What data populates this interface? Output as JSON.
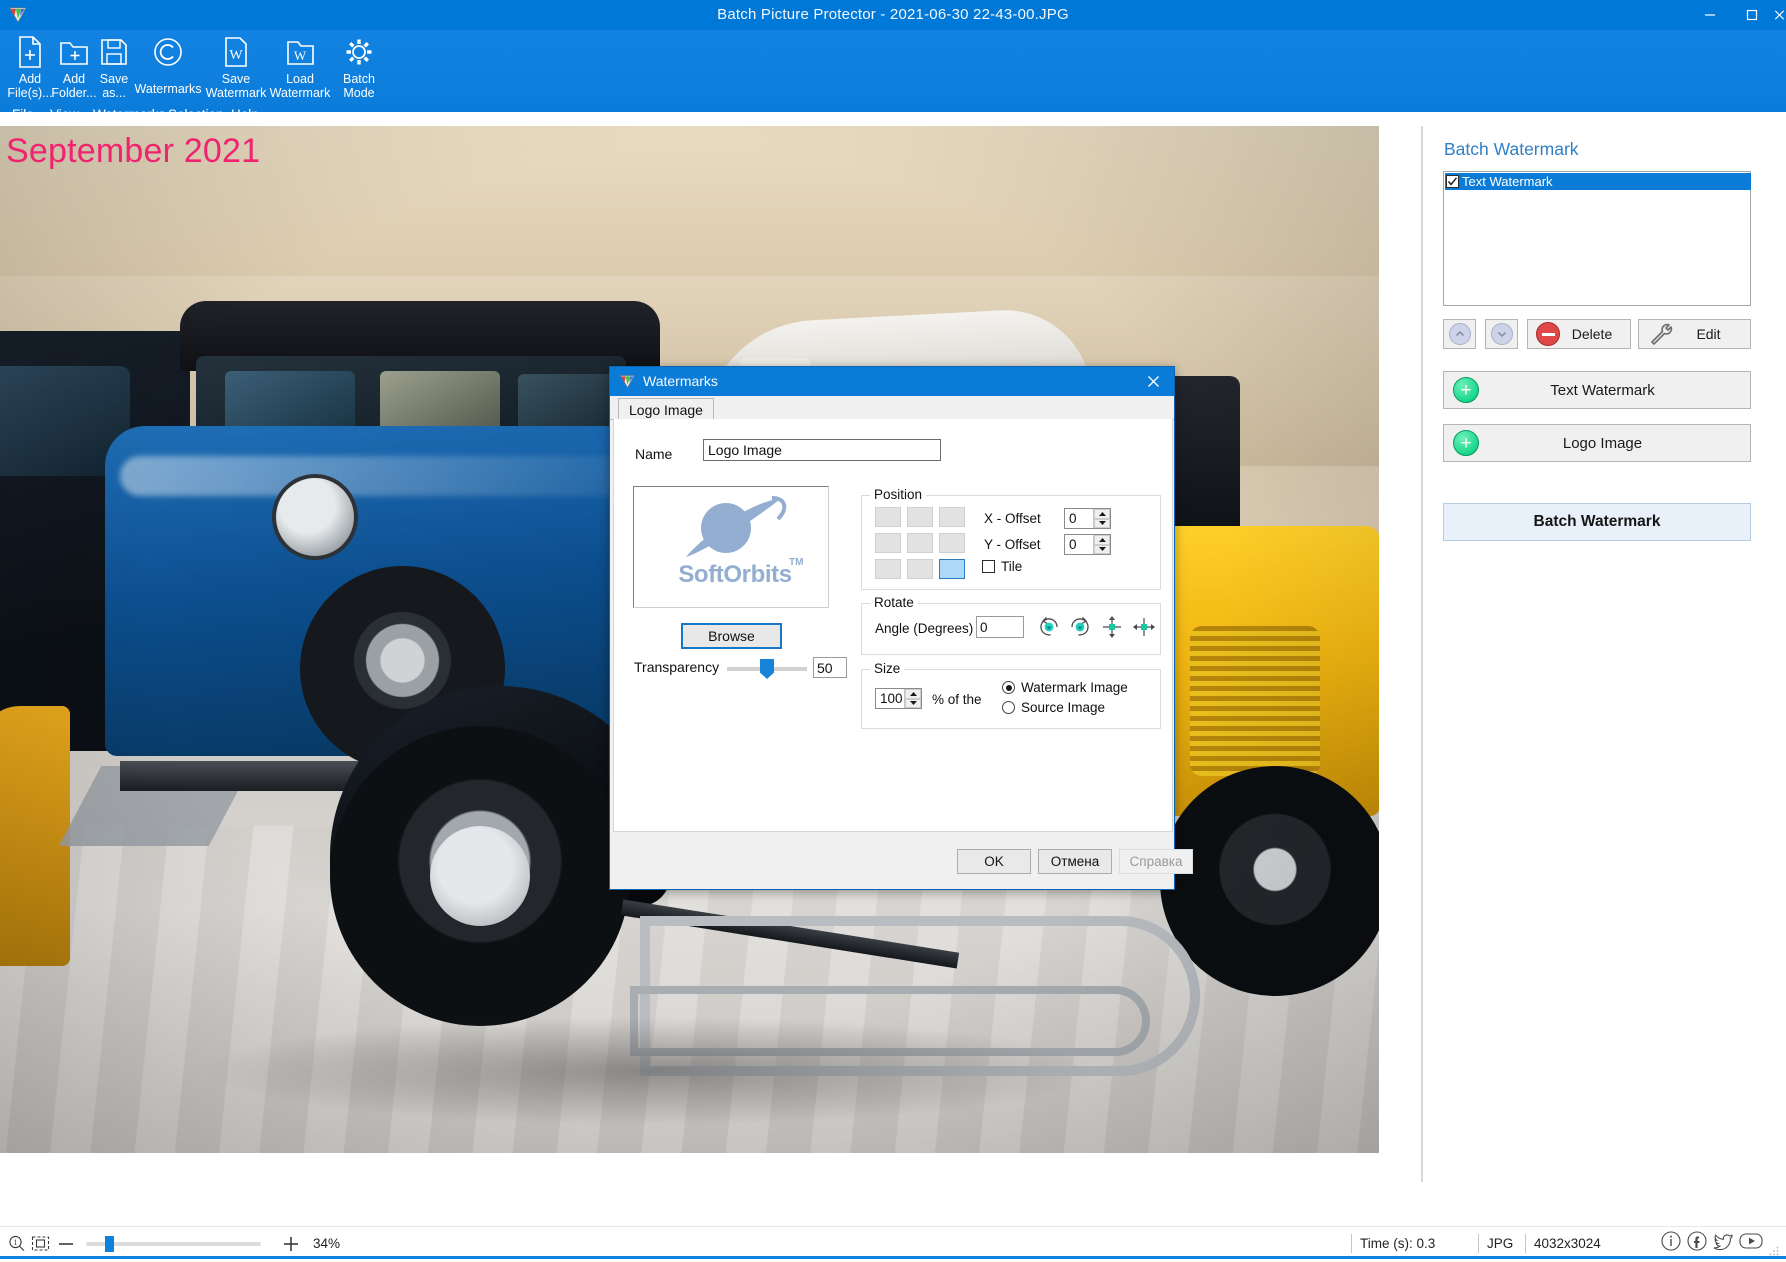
{
  "window": {
    "title": "Batch Picture Protector - 2021-06-30 22-43-00.JPG",
    "app_icon": "app-logo-icon",
    "controls": {
      "minimize": "minimize-icon",
      "maximize": "maximize-icon",
      "close": "close-icon"
    },
    "accent_color": "#0b82e0"
  },
  "toolbar": {
    "buttons": [
      {
        "icon": "add-file-icon",
        "label": "Add\nFile(s)..."
      },
      {
        "icon": "add-folder-icon",
        "label": "Add\nFolder..."
      },
      {
        "icon": "save-as-icon",
        "label": "Save\nas..."
      },
      {
        "icon": "copyright-icon",
        "label": "Watermarks"
      },
      {
        "icon": "save-watermark-icon",
        "label": "Save\nWatermark"
      },
      {
        "icon": "load-watermark-icon",
        "label": "Load\nWatermark"
      },
      {
        "icon": "gear-icon",
        "label": "Batch\nMode"
      }
    ]
  },
  "menubar": {
    "items": [
      "File",
      "View",
      "Watermarks",
      "Selection",
      "Help"
    ]
  },
  "canvas": {
    "watermark_overlay_text": "September 2021",
    "watermark_overlay_color": "#f0246e"
  },
  "right_panel": {
    "title": "Batch Watermark",
    "list": [
      {
        "label": "Text Watermark",
        "checked": true,
        "selected": true
      }
    ],
    "move_up": "chevron-up-icon",
    "move_down": "chevron-down-icon",
    "delete_label": "Delete",
    "delete_icon": "minus-circle-icon",
    "edit_label": "Edit",
    "edit_icon": "wrench-icon",
    "add_text_watermark_label": "Text Watermark",
    "add_logo_image_label": "Logo Image",
    "add_icon": "plus-circle-icon",
    "batch_watermark_label": "Batch Watermark"
  },
  "dialog": {
    "title": "Watermarks",
    "icon": "app-logo-icon",
    "close_icon": "close-icon",
    "tab": "Logo Image",
    "name_label": "Name",
    "name_value": "Logo Image",
    "logo_preview": {
      "brand": "SoftOrbits",
      "trademark": "TM",
      "planet_icon": "planet-icon",
      "color": "#93aed0"
    },
    "browse_label": "Browse",
    "transparency_label": "Transparency",
    "transparency_value": "50",
    "position": {
      "legend": "Position",
      "grid_selected_index": 8,
      "x_offset_label": "X - Offset",
      "x_offset_value": "0",
      "y_offset_label": "Y - Offset",
      "y_offset_value": "0",
      "tile_label": "Tile",
      "tile_checked": false
    },
    "rotate": {
      "legend": "Rotate",
      "angle_label": "Angle (Degrees)",
      "angle_value": "0",
      "icons": [
        "rotate-ccw-icon",
        "rotate-cw-icon",
        "flip-vertical-icon",
        "flip-horizontal-icon"
      ]
    },
    "size": {
      "legend": "Size",
      "percent_value": "100",
      "percent_label": "% of the",
      "options": [
        "Watermark Image",
        "Source Image"
      ],
      "selected_option": "Watermark Image"
    },
    "buttons": {
      "ok": "OK",
      "cancel": "Отмена",
      "help": "Справка"
    }
  },
  "statusbar": {
    "zoom_icon": "zoom-icon",
    "fit_icon": "fit-to-window-icon",
    "minus": "minus-icon",
    "plus": "plus-icon",
    "zoom_percent": "34%",
    "time": "Time (s): 0.3",
    "format": "JPG",
    "dimensions": "4032x3024",
    "social": [
      "info-icon",
      "facebook-icon",
      "twitter-icon",
      "youtube-icon"
    ]
  }
}
